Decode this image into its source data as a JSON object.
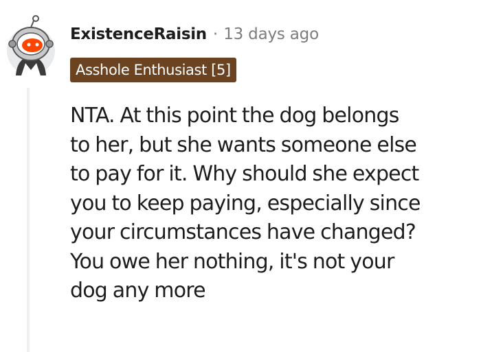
{
  "comment": {
    "author": "ExistenceRaisin",
    "separator": "·",
    "timestamp": "13 days ago",
    "flair": "Asshole Enthusiast [5]",
    "avatar_icon": "snoo-avatar-icon",
    "body_lines": [
      "NTA. At this point the dog belongs",
      "to her, but she wants someone else",
      "to pay for it. Why should she expect",
      "you to keep paying, especially since",
      "your circumstances have changed?",
      "You owe her nothing, it's not your",
      "dog any more"
    ]
  },
  "colors": {
    "flair_bg": "#6b4320",
    "meta_text": "#7c7c7c",
    "thread_line": "#edeff1",
    "avatar_orange": "#ff4500"
  }
}
